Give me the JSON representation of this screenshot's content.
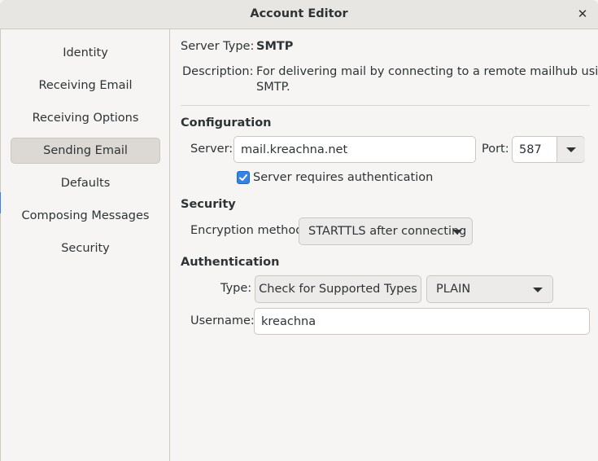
{
  "window": {
    "title": "Account Editor"
  },
  "sidebar": {
    "items": [
      {
        "label": "Identity"
      },
      {
        "label": "Receiving Email"
      },
      {
        "label": "Receiving Options"
      },
      {
        "label": "Sending Email",
        "selected": true
      },
      {
        "label": "Defaults"
      },
      {
        "label": "Composing Messages"
      },
      {
        "label": "Security"
      }
    ]
  },
  "server_info": {
    "type_label": "Server Type:",
    "type_value": "SMTP",
    "description_label": "Description:",
    "description_line1": "For delivering mail by connecting to a remote mailhub using",
    "description_line2": "SMTP."
  },
  "configuration": {
    "heading": "Configuration",
    "server_label": "Server:",
    "server_value": "mail.kreachna.net",
    "port_label": "Port:",
    "port_value": "587",
    "auth_required_label": "Server requires authentication",
    "auth_required_checked": true
  },
  "security": {
    "heading": "Security",
    "encryption_label": "Encryption method:",
    "encryption_value": "STARTTLS after connecting"
  },
  "authentication": {
    "heading": "Authentication",
    "type_label": "Type:",
    "check_button_label": "Check for Supported Types",
    "type_value": "PLAIN",
    "username_label": "Username:",
    "username_value": "kreachna"
  },
  "colors": {
    "accent": "#3584e4",
    "selected_bg": "#dcd8d4"
  }
}
